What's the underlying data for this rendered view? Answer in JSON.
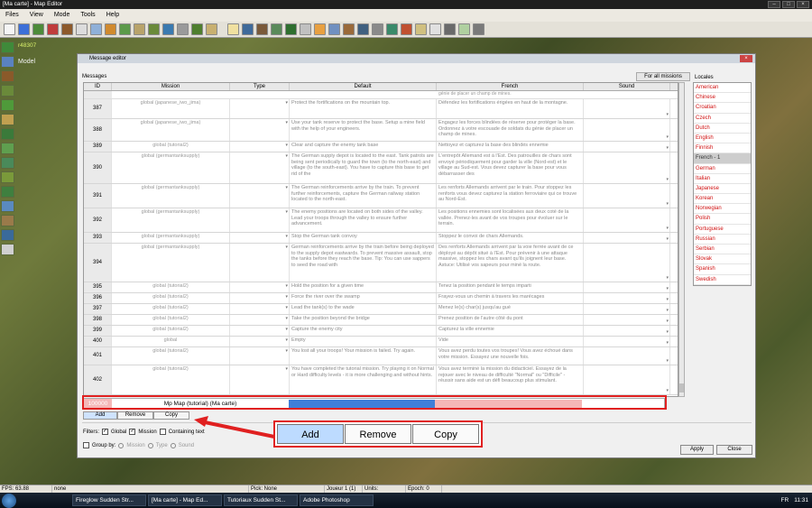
{
  "app": {
    "title": "[Ma carte] - Map Editor"
  },
  "menu": [
    "Files",
    "View",
    "Mode",
    "Tools",
    "Help"
  ],
  "overlay": {
    "coord": "r48307",
    "mode": "Model"
  },
  "editor": {
    "title": "Message editor",
    "messages_label": "Messages",
    "all_missions_btn": "For all missions",
    "locales_label": "Locales",
    "columns": [
      "ID",
      "Mission",
      "Type",
      "Default",
      "French",
      "Sound"
    ],
    "rows": [
      {
        "id": "387",
        "mission": "global (japanese_iwo_jima)",
        "default": "Protect the fortifications on the mountain top.",
        "french": "Défendez les fortifications érigées en haut de la montagne.",
        "h": 22
      },
      {
        "id": "388",
        "mission": "global (japanese_iwo_jima)",
        "default": "Use your tank reserve to protect the base. Setup a mine field with the help of your engineers.",
        "french": "Engagez les forces blindées de réserve pour protéger la base. Ordonnez à votre escouade de soldats du génie de placer un champ de mines.",
        "h": 25
      },
      {
        "id": "389",
        "mission": "global (tutorial2)",
        "default": "Clear and capture the enemy tank base",
        "french": "Nettoyez et capturez la base des blindés ennemie",
        "h": 12
      },
      {
        "id": "390",
        "mission": "global (germantanksupply)",
        "default": "The German supply depot is located to the east. Tank patrols are being sent periodically to guard the town (to the north-east) and village (to the south-east). You have to capture this base to get rid of the",
        "french": "L'entrepôt Allemand est à l'Est. Des patrouilles de chars sont envoyé périodiquement pour garder la ville (Nord-est) et le village au Sud-est. Vous devez capturer la base pour vous débarrasser des",
        "h": 35
      },
      {
        "id": "391",
        "mission": "global (germantanksupply)",
        "default": "The German reinforcements arrive by the train. To prevent further reinforcements, capture the German railway station located to the north-east.",
        "french": "Les renforts Allemands arrivent par le train. Pour stoppez les renforts vous devez capturez la station ferroviaire qui ce trouve au Nord-Est.",
        "h": 27
      },
      {
        "id": "392",
        "mission": "global (germantanksupply)",
        "default": "The enemy positions are located on both sides of the valley. Lead your troops through the valley to ensure further advancement.",
        "french": "Les positions ennemies sont localisées aux deux coté de la vallée. Prenez-les avant de vos troupes pour évoluer sur le terrain.",
        "h": 27
      },
      {
        "id": "393",
        "mission": "global (germantanksupply)",
        "default": "Stop the German tank convoy",
        "french": "Stoppez le convoi de chars Allemands.",
        "h": 12
      },
      {
        "id": "394",
        "mission": "global (germantanksupply)",
        "default": "German reinforcements arrive by the train before being deployed to the supply depot eastwards. To prevent massive assault, stop the tanks before they reach the base. Tip: You can use sappers to seed the road with",
        "french": "Des renforts Allemands arrivent par la voie ferrée avant de ce déployé au dépôt situé à l'Est. Pour prévenir à une attaque massive, stoppez les chars avant qu'ils joignent leur base. Astuce: Utilisé vos sapeurs pour miné la route.",
        "h": 43
      },
      {
        "id": "395",
        "mission": "global (tutorial2)",
        "default": "Hold the position for a given time",
        "french": "Tenez la position pendant le temps imparti",
        "h": 12
      },
      {
        "id": "396",
        "mission": "global (tutorial2)",
        "default": "Force the river over the swamp",
        "french": "Frayez-vous un chemin à travers les marécages",
        "h": 12
      },
      {
        "id": "397",
        "mission": "global (tutorial2)",
        "default": "Lead the tank(s) to the wade",
        "french": "Menez le(s) char(s) jusqu'au gué",
        "h": 12
      },
      {
        "id": "398",
        "mission": "global (tutorial2)",
        "default": "Take the position beyond the bridge",
        "french": "Prenez position de l'autre côté du pont",
        "h": 12
      },
      {
        "id": "399",
        "mission": "global (tutorial2)",
        "default": "Capture the enemy city",
        "french": "Capturez la ville ennemie",
        "h": 12
      },
      {
        "id": "400",
        "mission": "global",
        "default": "Empty",
        "french": "Vide",
        "h": 12
      },
      {
        "id": "401",
        "mission": "global (tutorial2)",
        "default": "You lost all your troops! Your mission is failed. Try again.",
        "french": "Vous avez perdu toutes vos troupes! Vous avez échoué dans votre mission. Essayez une nouvelle fois.",
        "h": 20
      },
      {
        "id": "402",
        "mission": "global (tutorial2)",
        "default": "You have completed the tutorial mission. Try playing it on Normal or Hard difficulty levels - it is more challenging and without hints.",
        "french": "Vous avez terminé la mission du didacticiel. Essayez de la rejouer avec le niveau de difficulté \"Normal\" ou \"Difficile\" - réussir sans aide est un défi beaucoup plus stimulant.",
        "h": 33
      }
    ],
    "new_row": {
      "id": "100000",
      "mission": "Mp Map (tutorial) (Ma carte)"
    },
    "buttons": {
      "add": "Add",
      "remove": "Remove",
      "copy": "Copy",
      "apply": "Apply",
      "close": "Close"
    },
    "filters": {
      "label": "Filters:",
      "global": "Global",
      "mission": "Mission",
      "containing": "Containing text"
    },
    "groupby": {
      "label": "Group by:",
      "mission": "Mission",
      "type": "Type",
      "sound": "Sound"
    },
    "locales": [
      "American",
      "Chinese",
      "Croatian",
      "Czech",
      "Dutch",
      "English",
      "Finnish",
      "French - 1",
      "German",
      "Italian",
      "Japanese",
      "Korean",
      "Norwegian",
      "Polish",
      "Portuguese",
      "Russian",
      "Serbian",
      "Slovak",
      "Spanish",
      "Swedish"
    ],
    "selected_locale": "French - 1"
  },
  "status": {
    "fps": "FPS: 63.88",
    "none": "none",
    "pick": "Pick: None",
    "player": "Joueur 1 (1)",
    "units": "Units:",
    "epoch": "Epoch: 0"
  },
  "taskbar": {
    "items": [
      "Fireglow Sudden Str...",
      "[Ma carte] - Map Ed...",
      "Tutoriaux Sudden St...",
      "Adobe Photoshop"
    ],
    "lang": "FR",
    "clock": "11:31"
  },
  "colors": {
    "highlight": "#e02020",
    "selection_blue": "#3f7fd8"
  }
}
